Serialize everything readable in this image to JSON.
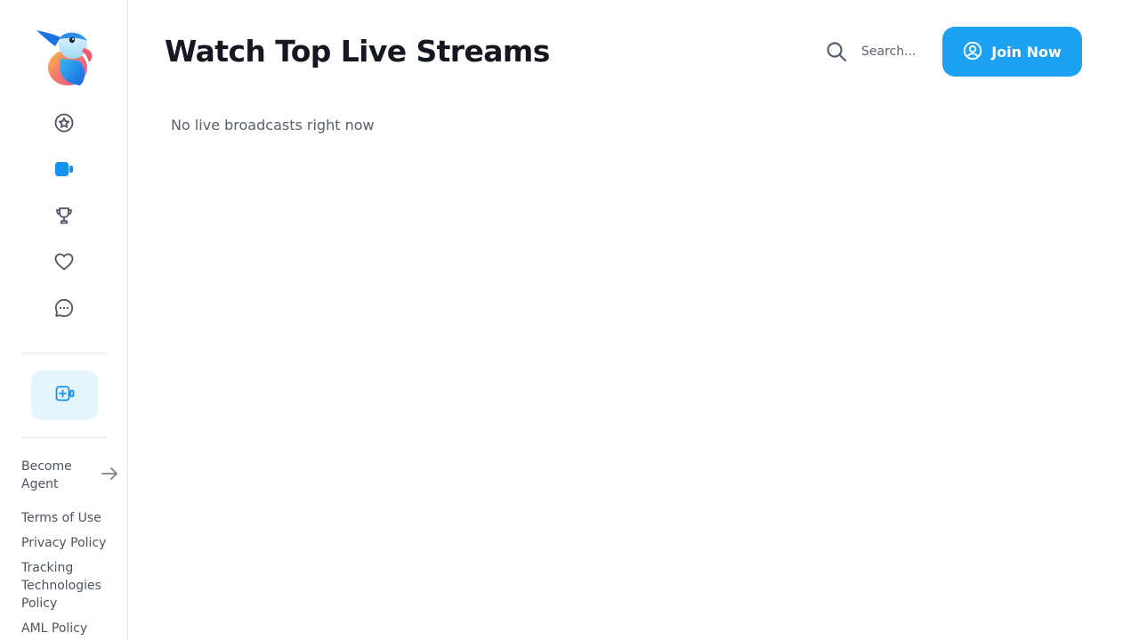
{
  "app": {
    "logo_name": "parrot-logo",
    "accent_color": "#1da1f2"
  },
  "sidebar": {
    "nav_items": [
      {
        "icon": "star-icon",
        "active": false
      },
      {
        "icon": "video-camera-icon",
        "active": true
      },
      {
        "icon": "trophy-icon",
        "active": false
      },
      {
        "icon": "heart-icon",
        "active": false
      },
      {
        "icon": "chat-bubble-icon",
        "active": false
      }
    ],
    "go_live_icon": "add-video-icon",
    "become_agent_label": "Become Agent",
    "footer_links": [
      "Terms of Use",
      "Privacy Policy",
      "Tracking Technologies Policy",
      "AML Policy"
    ]
  },
  "header": {
    "title": "Watch Top Live Streams",
    "search": {
      "placeholder": "Search..."
    },
    "join_button_label": "Join Now"
  },
  "main": {
    "empty_message": "No live broadcasts right now"
  }
}
